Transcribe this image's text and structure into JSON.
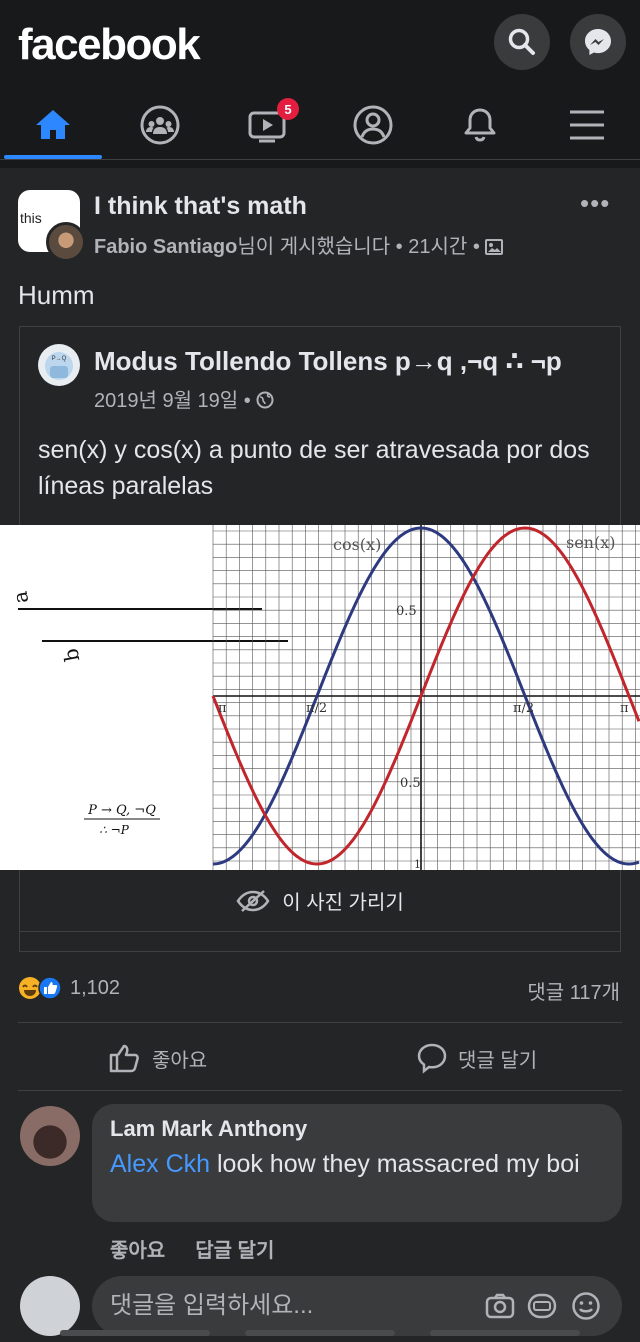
{
  "header": {
    "logo": "facebook",
    "search_icon": "search-icon",
    "messenger_icon": "messenger-icon"
  },
  "nav": {
    "tabs": [
      {
        "name": "home",
        "icon": "home-icon",
        "active": true
      },
      {
        "name": "groups",
        "icon": "groups-icon"
      },
      {
        "name": "watch",
        "icon": "watch-icon",
        "badge": "5"
      },
      {
        "name": "profile",
        "icon": "profile-icon"
      },
      {
        "name": "notifications",
        "icon": "bell-icon"
      },
      {
        "name": "menu",
        "icon": "menu-icon"
      }
    ],
    "accent_color": "#2d88ff"
  },
  "post": {
    "group_avatar_text": "this",
    "group_name": "I think that's math",
    "author": "Fabio Santiago",
    "meta_suffix": "님이 게시했습니다 • 21시간 •",
    "text": "Humm",
    "shared": {
      "title": "Modus Tollendo Tollens p→q ,¬q ∴ ¬p",
      "date": "2019년 9월 19일 •",
      "text": "sen(x) y cos(x) a punto de ser atravesada por dos líneas paralelas",
      "photo": {
        "line_label_a": "a",
        "line_label_b": "b",
        "formula_top": "P → Q, ¬Q",
        "formula_bottom": "∴ ¬P",
        "cos_label": "cos(x)",
        "sen_label": "sen(x)",
        "tick_05": "0.5",
        "tick_neg05": "0.5",
        "tick_neg1": "1",
        "tick_neg_pi": "π",
        "tick_neg_pi2": "π/2",
        "tick_pi2": "π/2",
        "tick_pi": "π",
        "cos_color": "#2e3a80",
        "sen_color": "#c0262b"
      },
      "hide_label": "이 사진 가리기"
    },
    "reaction_count": "1,102",
    "comment_count": "댓글 117개",
    "like_label": "좋아요",
    "comment_label": "댓글 달기"
  },
  "comment": {
    "author": "Lam Mark Anthony",
    "mention": "Alex Ckh",
    "text": " look how they massacred my boi",
    "like": "좋아요",
    "reply": "답글 달기"
  },
  "composer": {
    "placeholder": "댓글을 입력하세요..."
  }
}
